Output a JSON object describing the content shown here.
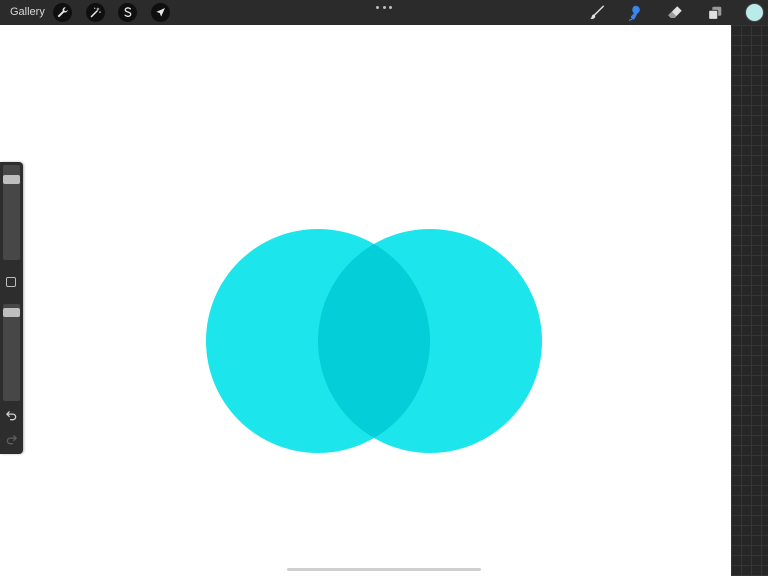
{
  "toolbar": {
    "gallery_label": "Gallery",
    "left_tools": [
      "wrench-icon",
      "magic-wand-icon",
      "selection-s-icon",
      "transform-arrow-icon"
    ],
    "more_icon": "more-dots-icon",
    "right_tools": [
      "brush-icon",
      "smudge-icon",
      "eraser-icon",
      "layers-icon"
    ],
    "active_tool": "smudge-icon",
    "active_tool_color": "#3a86f0",
    "current_color": "#b9ece9"
  },
  "sidebar": {
    "brush_size_level": 0.12,
    "opacity_level": 0.05,
    "modify_icon": "modify-square-icon",
    "undo_icon": "undo-icon",
    "redo_icon": "redo-icon"
  },
  "canvas": {
    "background": "#ffffff",
    "circle_color": "#1de5ec",
    "overlap_color": "#04ced8"
  }
}
